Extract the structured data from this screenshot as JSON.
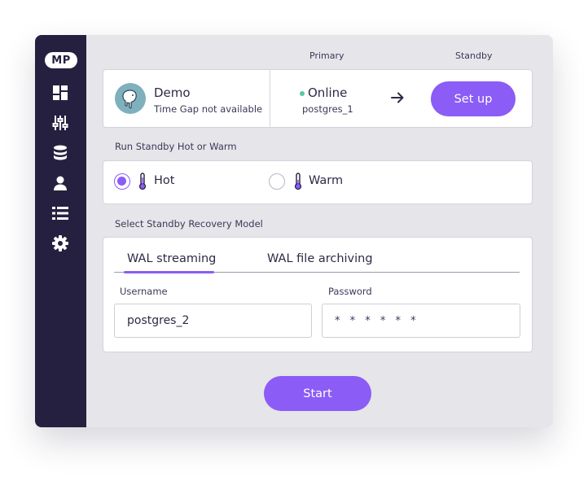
{
  "sidebar": {
    "logo_text": "MP",
    "items": [
      {
        "icon": "dashboard-icon"
      },
      {
        "icon": "sliders-icon"
      },
      {
        "icon": "database-icon"
      },
      {
        "icon": "user-icon"
      },
      {
        "icon": "list-icon"
      },
      {
        "icon": "gear-icon"
      }
    ]
  },
  "columns": {
    "primary": "Primary",
    "standby": "Standby"
  },
  "cluster": {
    "name": "Demo",
    "time_gap": "Time Gap not available",
    "status": "Online",
    "status_color": "#58c9a2",
    "primary_host": "postgres_1",
    "setup_label": "Set up"
  },
  "mode": {
    "heading": "Run Standby Hot or Warm",
    "options": [
      {
        "label": "Hot",
        "selected": true
      },
      {
        "label": "Warm",
        "selected": false
      }
    ]
  },
  "recovery": {
    "heading": "Select Standby Recovery Model",
    "tabs": [
      {
        "label": "WAL streaming",
        "active": true
      },
      {
        "label": "WAL file archiving",
        "active": false
      }
    ],
    "username_label": "Username",
    "username_value": "postgres_2",
    "password_label": "Password",
    "password_value": "* * * * * *"
  },
  "start_label": "Start",
  "colors": {
    "accent": "#8b5cf6",
    "sidebar": "#262040",
    "panel": "#e6e5ea"
  }
}
